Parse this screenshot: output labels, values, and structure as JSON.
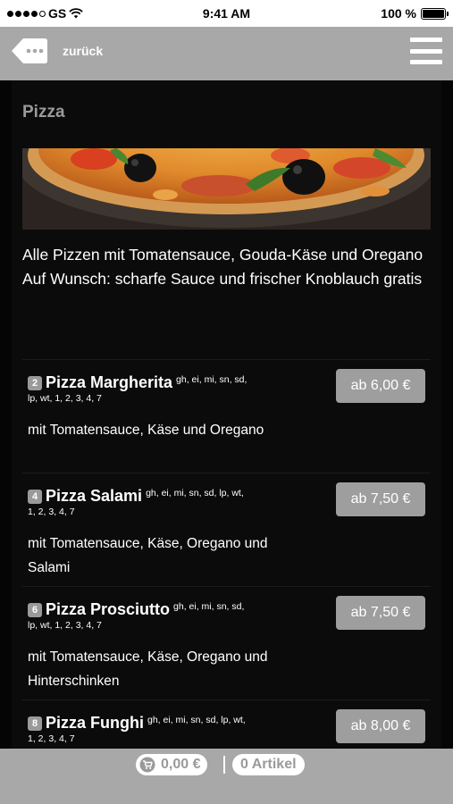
{
  "status_bar": {
    "carrier": "GS",
    "time": "9:41 AM",
    "battery": "100 %"
  },
  "nav": {
    "back_label": "zurück"
  },
  "section": {
    "title": "Pizza",
    "intro_line1": "Alle Pizzen mit Tomatensauce, Gouda-Käse und Oregano",
    "intro_line2": "Auf Wunsch: scharfe Sauce und frischer Knoblauch gratis"
  },
  "items": [
    {
      "number": "2",
      "name": "Pizza Margherita",
      "codes_a": "gh, ei, mi, sn, sd,",
      "codes_b": "lp, wt, 1, 2, 3, 4, 7",
      "description": "mit Tomatensauce, Käse und Oregano",
      "price": "ab 6,00 €"
    },
    {
      "number": "4",
      "name": "Pizza Salami",
      "codes_a": "gh, ei, mi, sn, sd, lp, wt,",
      "codes_b": "1, 2, 3, 4, 7",
      "description": "mit Tomatensauce, Käse, Oregano und Salami",
      "price": "ab 7,50 €"
    },
    {
      "number": "6",
      "name": "Pizza Prosciutto",
      "codes_a": "gh, ei, mi, sn, sd,",
      "codes_b": "lp, wt, 1, 2, 3, 4, 7",
      "description": "mit Tomatensauce, Käse, Oregano und Hinterschinken",
      "price": "ab 7,50 €"
    },
    {
      "number": "8",
      "name": "Pizza Funghi",
      "codes_a": "gh, ei, mi, sn, sd, lp, wt,",
      "codes_b": "1, 2, 3, 4, 7",
      "description": "",
      "price": "ab 8,00 €"
    }
  ],
  "cart": {
    "total": "0,00 €",
    "count": "0 Artikel"
  },
  "colors": {
    "nav_gray": "#a8a8a8",
    "content_bg": "#0b0b0b",
    "price_button": "#9e9e9e"
  },
  "icons": [
    "back-icon",
    "menu-icon",
    "cart-icon",
    "wifi-icon",
    "battery-icon"
  ]
}
